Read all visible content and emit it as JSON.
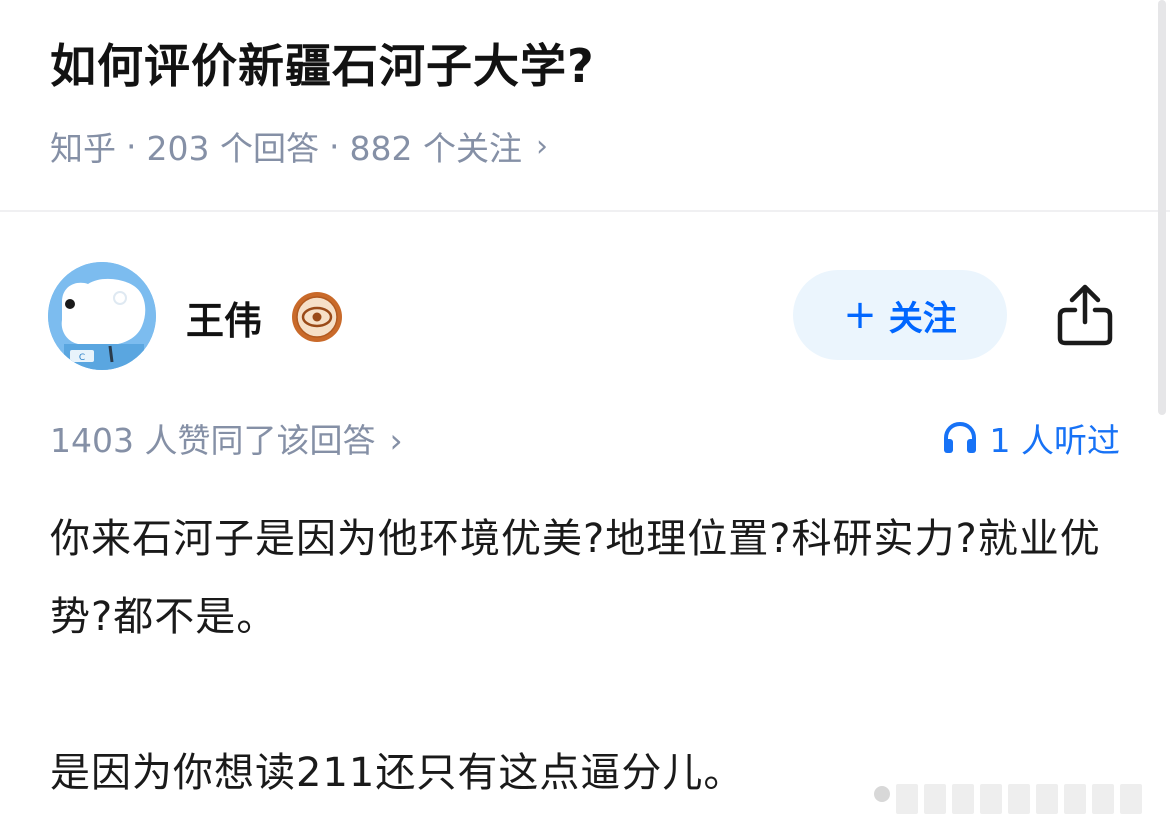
{
  "question": {
    "title": "如何评价新疆石河子大学?",
    "source": "知乎",
    "answers": "203 个回答",
    "followers": "882 个关注",
    "separator": "·",
    "chevron": "›"
  },
  "author": {
    "name": "王伟",
    "avatar_icon": "polar-bear-avatar-icon",
    "badge_icon": "eye-badge-icon",
    "follow_label": "关注",
    "follow_plus": "+",
    "share_icon": "share-icon"
  },
  "stats": {
    "agree": "1403 人赞同了该回答",
    "chevron": "›",
    "listen": "1 人听过",
    "listen_icon": "headphones-icon"
  },
  "answer": {
    "paragraph1": "你来石河子是因为他环境优美?地理位置?科研实力?就业优势?都不是。",
    "paragraph2": "是因为你想读211还只有这点逼分儿。"
  },
  "colors": {
    "primary": "#0066ff",
    "meta_gray": "#8590a6",
    "follow_bg": "#ebf5fd",
    "badge_orange": "#c96a2a"
  }
}
